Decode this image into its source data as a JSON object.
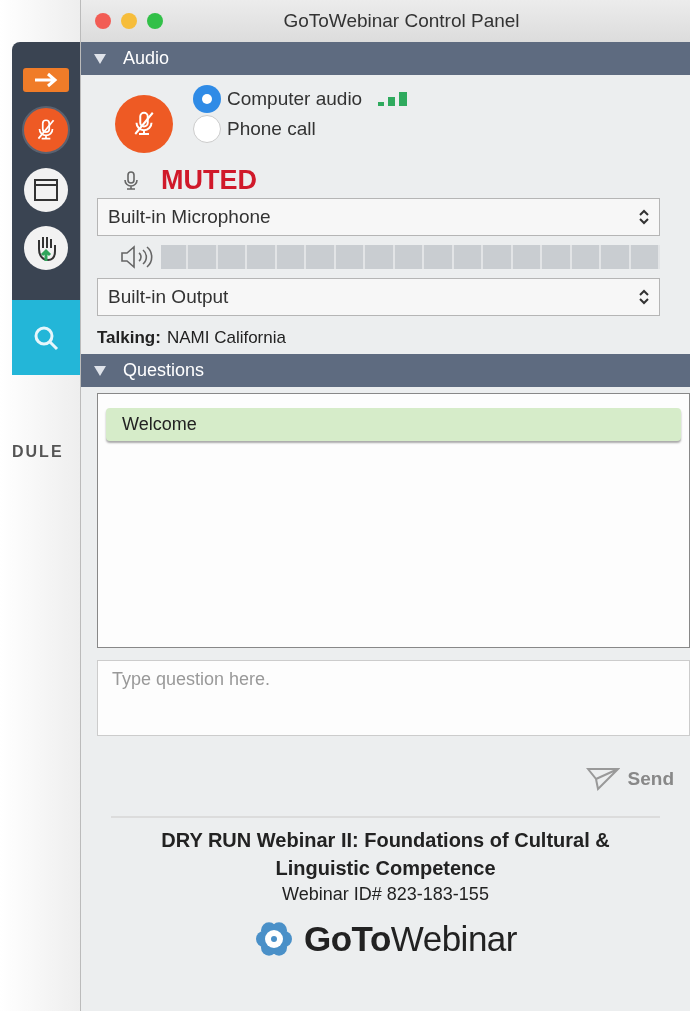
{
  "window": {
    "title": "GoToWebinar Control Panel"
  },
  "sidebar": {
    "cut_label": "DULE"
  },
  "audio": {
    "title": "Audio",
    "expanded": true,
    "muted": true,
    "status": "MUTED",
    "options": [
      {
        "label": "Computer audio",
        "selected": true
      },
      {
        "label": "Phone call",
        "selected": false
      }
    ],
    "microphone": "Built-in Microphone",
    "level": 0,
    "output": "Built-in Output",
    "talking_label": "Talking:",
    "talking_name": "NAMI California"
  },
  "questions": {
    "title": "Questions",
    "expanded": true,
    "items": [
      {
        "text": "Welcome"
      }
    ],
    "placeholder": "Type question here.",
    "send": "Send"
  },
  "footer": {
    "title": "DRY RUN Webinar II: Foundations of Cultural & Linguistic Competence",
    "webinar_id": "Webinar ID# 823-183-155",
    "logo": "**GoTo**Webinar"
  }
}
